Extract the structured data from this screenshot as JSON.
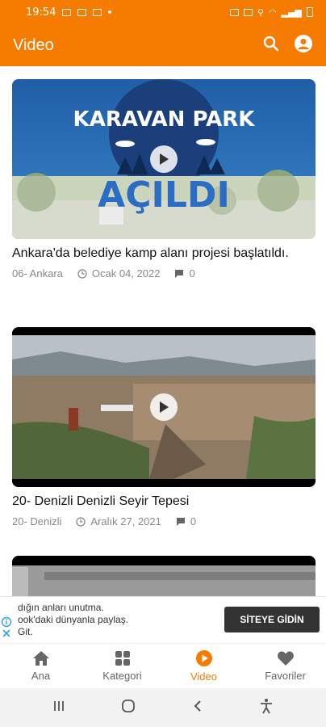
{
  "status_bar": {
    "time": "19:54"
  },
  "app_bar": {
    "title": "Video"
  },
  "videos": [
    {
      "thumb_heading": "KARAVAN PARK",
      "thumb_subheading": "AÇILDI",
      "title": "Ankara'da belediye kamp alanı projesi başlatıldı.",
      "category": "06- Ankara",
      "date": "Ocak 04, 2022",
      "comments": "0"
    },
    {
      "title": "20- Denizli Denizli Seyir Tepesi",
      "category": "20- Denizli",
      "date": "Aralık 27, 2021",
      "comments": "0"
    }
  ],
  "ad": {
    "line1": "dığın anları unutma.",
    "line2": "ook'daki dünyanla paylaş.",
    "line3": "Git.",
    "button_label": "SİTEYE GİDİN"
  },
  "bottom_nav": [
    {
      "label": "Ana",
      "icon": "home-icon"
    },
    {
      "label": "Kategori",
      "icon": "grid-icon"
    },
    {
      "label": "Video",
      "icon": "play-circle-icon"
    },
    {
      "label": "Favoriler",
      "icon": "heart-icon"
    }
  ],
  "colors": {
    "primary": "#f57c00",
    "active_tab": "#f57c00",
    "ad_button": "#333333"
  }
}
